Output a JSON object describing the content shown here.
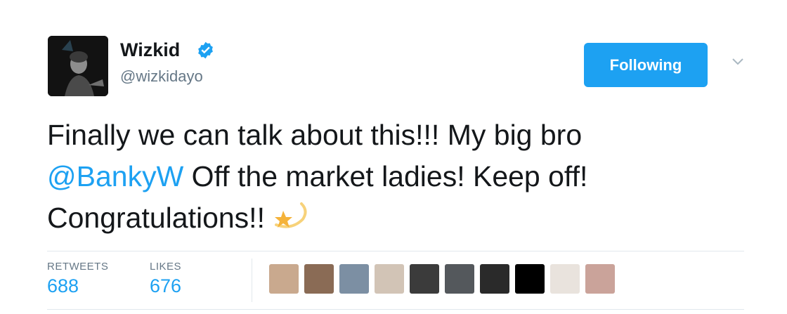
{
  "tweet": {
    "author": {
      "display_name": "Wizkid",
      "handle": "@wizkidayo",
      "verified": true,
      "avatar_icon": "profile-photo"
    },
    "follow_button_label": "Following",
    "menu_icon": "chevron-down-icon",
    "text_before_mention": "Finally we can talk about this!!! My big bro",
    "mention": "@BankyW",
    "text_after_mention": " Off the market ladies! Keep off!",
    "text_line3": "Congratulations!!",
    "emoji_icon": "shooting-star-emoji",
    "stats": {
      "retweets_label": "RETWEETS",
      "retweets_count": "688",
      "likes_label": "LIKES",
      "likes_count": "676"
    },
    "liker_avatars": [
      "liker-1",
      "liker-2",
      "liker-3",
      "liker-4",
      "liker-5",
      "liker-6",
      "liker-7",
      "liker-8",
      "liker-9",
      "liker-10"
    ]
  },
  "colors": {
    "accent": "#1da1f2",
    "text": "#14171a",
    "secondary": "#657786",
    "divider": "#e1e8ed"
  }
}
